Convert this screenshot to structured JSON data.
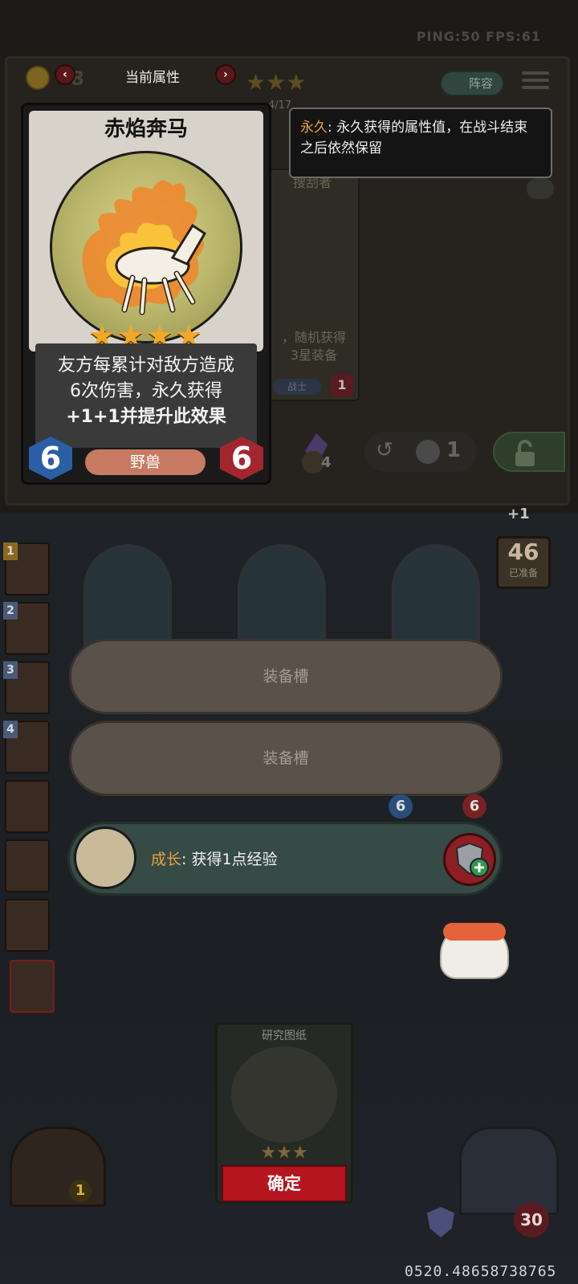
{
  "hud": {
    "ping_fps": "PING:50  FPS:61",
    "gold_partial": "8",
    "page_counter": "4/17"
  },
  "attributes_header": {
    "title": "当前属性",
    "prev_label": "‹",
    "next_label": "›"
  },
  "shop_stars": "★★★",
  "lineup_button": "阵容",
  "tooltip": {
    "keyword": "永久",
    "text": ": 永久获得的属性值，在战斗结束之后依然保留"
  },
  "card": {
    "name": "赤焰奔马",
    "stars": "★★★★",
    "description_line1": "友方每累计对敌方造成",
    "description_line2": "6次伤害，永久获得",
    "description_line3": "+1+1并提升此效果",
    "attack": "6",
    "health": "6",
    "tribe": "野兽"
  },
  "background_card": {
    "name_partial": "搜刮者",
    "text": "，随机获得\n3星装备",
    "class": "战士",
    "level": "1"
  },
  "panel_bottom": {
    "gem_count": "4",
    "reroll_count": "1"
  },
  "side_counter": {
    "plus": "+1",
    "ready_num": "46",
    "ready_label": "已准备"
  },
  "party": [
    {
      "num": "1"
    },
    {
      "num": "2"
    },
    {
      "num": "3"
    },
    {
      "num": "4"
    },
    {
      "num": ""
    },
    {
      "num": ""
    },
    {
      "num": ""
    },
    {
      "num": ""
    }
  ],
  "slots": {
    "slot1": "装备槽",
    "slot2": "装备槽"
  },
  "board_stats": {
    "left": "6",
    "right": "6"
  },
  "growth": {
    "keyword": "成长",
    "text": ": 获得1点经验"
  },
  "reward": {
    "title": "研究图纸",
    "stars": "★★★",
    "confirm": "确定"
  },
  "bottom": {
    "door_num": "1",
    "hp": "30",
    "id_text": "0520.48658738765"
  },
  "colors": {
    "accent_orange": "#e8a33c",
    "confirm_red": "#b5151f",
    "star_gold": "#f2a827",
    "growth_bg": "#364a46"
  }
}
